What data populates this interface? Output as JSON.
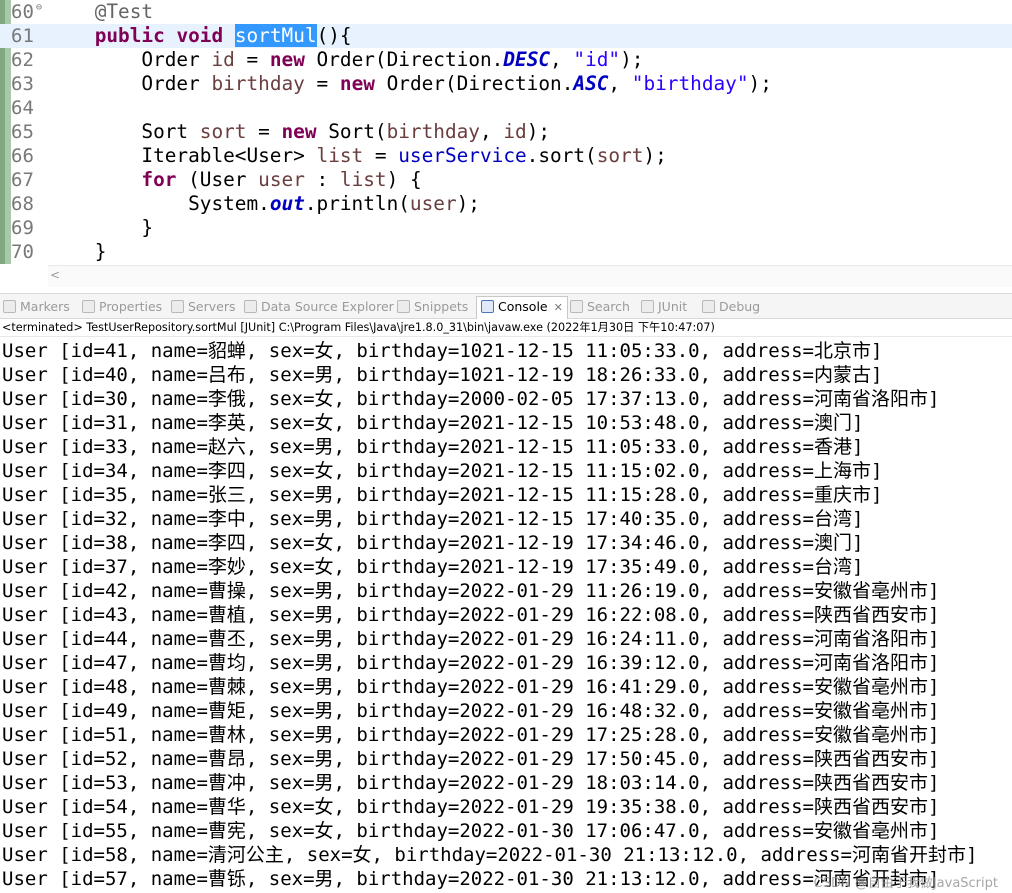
{
  "editor": {
    "lines": [
      {
        "num": "60",
        "fold": "⊖",
        "tokens": [
          [
            "    ",
            ""
          ],
          [
            "@Test",
            "ann"
          ]
        ]
      },
      {
        "num": "61",
        "current": true,
        "tokens": [
          [
            "    ",
            ""
          ],
          [
            "public",
            "kw"
          ],
          [
            " ",
            ""
          ],
          [
            "void",
            "kw"
          ],
          [
            " ",
            ""
          ],
          [
            "sortMul",
            "sel"
          ],
          [
            "(){",
            ""
          ]
        ]
      },
      {
        "num": "62",
        "tokens": [
          [
            "        Order ",
            ""
          ],
          [
            "id",
            "lv"
          ],
          [
            " = ",
            ""
          ],
          [
            "new",
            "kw"
          ],
          [
            " Order(Direction.",
            ""
          ],
          [
            "DESC",
            "fld"
          ],
          [
            ", ",
            ""
          ],
          [
            "\"id\"",
            "str"
          ],
          [
            ");",
            ""
          ]
        ]
      },
      {
        "num": "63",
        "tokens": [
          [
            "        Order ",
            ""
          ],
          [
            "birthday",
            "lv"
          ],
          [
            " = ",
            ""
          ],
          [
            "new",
            "kw"
          ],
          [
            " Order(Direction.",
            ""
          ],
          [
            "ASC",
            "fld"
          ],
          [
            ", ",
            ""
          ],
          [
            "\"birthday\"",
            "str"
          ],
          [
            ");",
            ""
          ]
        ]
      },
      {
        "num": "64",
        "tokens": [
          [
            "",
            ""
          ]
        ]
      },
      {
        "num": "65",
        "tokens": [
          [
            "        Sort ",
            ""
          ],
          [
            "sort",
            "lv"
          ],
          [
            " = ",
            ""
          ],
          [
            "new",
            "kw"
          ],
          [
            " Sort(",
            ""
          ],
          [
            "birthday",
            "lv"
          ],
          [
            ", ",
            ""
          ],
          [
            "id",
            "lv"
          ],
          [
            ");",
            ""
          ]
        ]
      },
      {
        "num": "66",
        "tokens": [
          [
            "        Iterable<User> ",
            ""
          ],
          [
            "list",
            "lv"
          ],
          [
            " = ",
            ""
          ],
          [
            "userService",
            "mf"
          ],
          [
            ".sort(",
            ""
          ],
          [
            "sort",
            "lv"
          ],
          [
            ");",
            ""
          ]
        ]
      },
      {
        "num": "67",
        "tokens": [
          [
            "        ",
            ""
          ],
          [
            "for",
            "kw"
          ],
          [
            " (User ",
            ""
          ],
          [
            "user",
            "lv"
          ],
          [
            " : ",
            ""
          ],
          [
            "list",
            "lv"
          ],
          [
            ") {",
            ""
          ]
        ]
      },
      {
        "num": "68",
        "tokens": [
          [
            "            System.",
            ""
          ],
          [
            "out",
            "fld"
          ],
          [
            ".println(",
            ""
          ],
          [
            "user",
            "lv"
          ],
          [
            ");",
            ""
          ]
        ]
      },
      {
        "num": "69",
        "tokens": [
          [
            "        }",
            ""
          ]
        ]
      },
      {
        "num": "70",
        "tokens": [
          [
            "    }",
            ""
          ]
        ]
      }
    ],
    "hscroll_arrow": "<"
  },
  "views": {
    "tabs": [
      {
        "label": "Markers",
        "icon": "markers-icon"
      },
      {
        "label": "Properties",
        "icon": "properties-icon"
      },
      {
        "label": "Servers",
        "icon": "servers-icon"
      },
      {
        "label": "Data Source Explorer",
        "icon": "data-source-explorer-icon"
      },
      {
        "label": "Snippets",
        "icon": "snippets-icon"
      },
      {
        "label": "Console",
        "icon": "console-icon",
        "active": true,
        "close": "✕"
      },
      {
        "label": "Search",
        "icon": "search-icon"
      },
      {
        "label": "JUnit",
        "icon": "junit-icon",
        "prefix": "Ju"
      },
      {
        "label": "Debug",
        "icon": "debug-icon"
      }
    ]
  },
  "console": {
    "status": "<terminated> TestUserRepository.sortMul [JUnit] C:\\Program Files\\Java\\jre1.8.0_31\\bin\\javaw.exe (2022年1月30日 下午10:47:07)",
    "lines": [
      "User [id=41, name=貂蝉, sex=女, birthday=1021-12-15 11:05:33.0, address=北京市]",
      "User [id=40, name=吕布, sex=男, birthday=1021-12-19 18:26:33.0, address=内蒙古]",
      "User [id=30, name=李俄, sex=女, birthday=2000-02-05 17:37:13.0, address=河南省洛阳市]",
      "User [id=31, name=李英, sex=女, birthday=2021-12-15 10:53:48.0, address=澳门]",
      "User [id=33, name=赵六, sex=男, birthday=2021-12-15 11:05:33.0, address=香港]",
      "User [id=34, name=李四, sex=女, birthday=2021-12-15 11:15:02.0, address=上海市]",
      "User [id=35, name=张三, sex=男, birthday=2021-12-15 11:15:28.0, address=重庆市]",
      "User [id=32, name=李中, sex=男, birthday=2021-12-15 17:40:35.0, address=台湾]",
      "User [id=38, name=李四, sex=女, birthday=2021-12-19 17:34:46.0, address=澳门]",
      "User [id=37, name=李妙, sex=女, birthday=2021-12-19 17:35:49.0, address=台湾]",
      "User [id=42, name=曹操, sex=男, birthday=2022-01-29 11:26:19.0, address=安徽省亳州市]",
      "User [id=43, name=曹植, sex=男, birthday=2022-01-29 16:22:08.0, address=陕西省西安市]",
      "User [id=44, name=曹丕, sex=男, birthday=2022-01-29 16:24:11.0, address=河南省洛阳市]",
      "User [id=47, name=曹均, sex=男, birthday=2022-01-29 16:39:12.0, address=河南省洛阳市]",
      "User [id=48, name=曹棘, sex=男, birthday=2022-01-29 16:41:29.0, address=安徽省亳州市]",
      "User [id=49, name=曹矩, sex=男, birthday=2022-01-29 16:48:32.0, address=安徽省亳州市]",
      "User [id=51, name=曹林, sex=男, birthday=2022-01-29 17:25:28.0, address=安徽省亳州市]",
      "User [id=52, name=曹昂, sex=男, birthday=2022-01-29 17:50:45.0, address=陕西省西安市]",
      "User [id=53, name=曹冲, sex=男, birthday=2022-01-29 18:03:14.0, address=陕西省西安市]",
      "User [id=54, name=曹华, sex=女, birthday=2022-01-29 19:35:38.0, address=陕西省西安市]",
      "User [id=55, name=曹宪, sex=女, birthday=2022-01-30 17:06:47.0, address=安徽省亳州市]",
      "User [id=58, name=清河公主, sex=女, birthday=2022-01-30 21:13:12.0, address=河南省开封市]",
      "User [id=57, name=曹铄, sex=男, birthday=2022-01-30 21:13:12.0, address=河南省开封市]"
    ]
  },
  "watermark": "CSDN @自由于我做JavaScript"
}
